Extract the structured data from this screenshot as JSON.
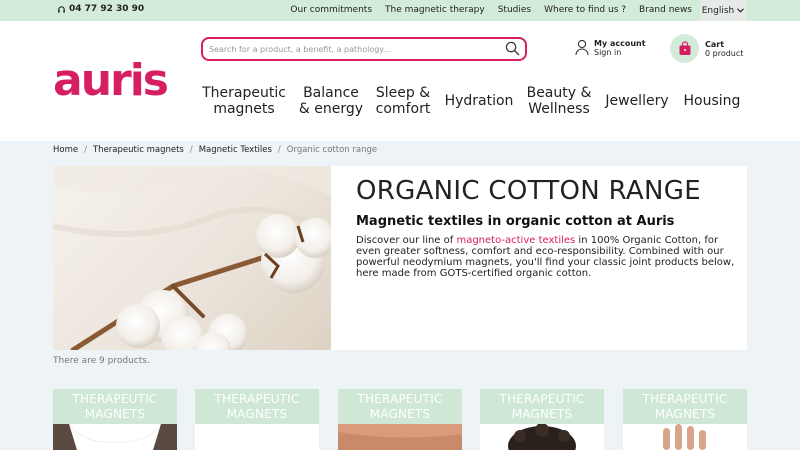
{
  "topbar": {
    "phone": "04 77 92 30 90",
    "links": [
      "Our commitments",
      "The magnetic therapy",
      "Studies",
      "Where to find us ?",
      "Brand news"
    ],
    "language": "English"
  },
  "header": {
    "logo": "auris",
    "search_placeholder": "Search for a product, a benefit, a pathology...",
    "account_title": "My account",
    "account_sub": "Sign in",
    "cart_title": "Cart",
    "cart_sub": "0 product",
    "brand_color": "#d61f63",
    "accent_green": "#d3ecd9"
  },
  "nav": [
    {
      "label": "Therapeutic magnets"
    },
    {
      "label": "Balance & energy"
    },
    {
      "label": "Sleep & comfort"
    },
    {
      "label": "Hydration"
    },
    {
      "label": "Beauty & Wellness"
    },
    {
      "label": "Jewellery"
    },
    {
      "label": "Housing"
    }
  ],
  "breadcrumb": [
    "Home",
    "Therapeutic magnets",
    "Magnetic Textiles",
    "Organic cotton range"
  ],
  "hero": {
    "title": "ORGANIC COTTON RANGE",
    "subtitle": "Magnetic textiles in organic cotton at Auris",
    "desc_pre": "Discover our line of ",
    "desc_link": "magneto-active textiles",
    "desc_post": " in 100% Organic Cotton, for even greater softness, comfort and eco-responsibility. Combined with our powerful neodymium magnets, you'll find your classic joint products below, here made from GOTS-certified organic cotton."
  },
  "product_count": "There are 9 products.",
  "products": [
    {
      "tag": "THERAPEUTIC MAGNETS",
      "image": "white-textile-top"
    },
    {
      "tag": "THERAPEUTIC MAGNETS",
      "image": "white-blank"
    },
    {
      "tag": "THERAPEUTIC MAGNETS",
      "image": "skin-torso"
    },
    {
      "tag": "THERAPEUTIC MAGNETS",
      "image": "curly-hair-head"
    },
    {
      "tag": "THERAPEUTIC MAGNETS",
      "image": "raised-hand"
    }
  ]
}
